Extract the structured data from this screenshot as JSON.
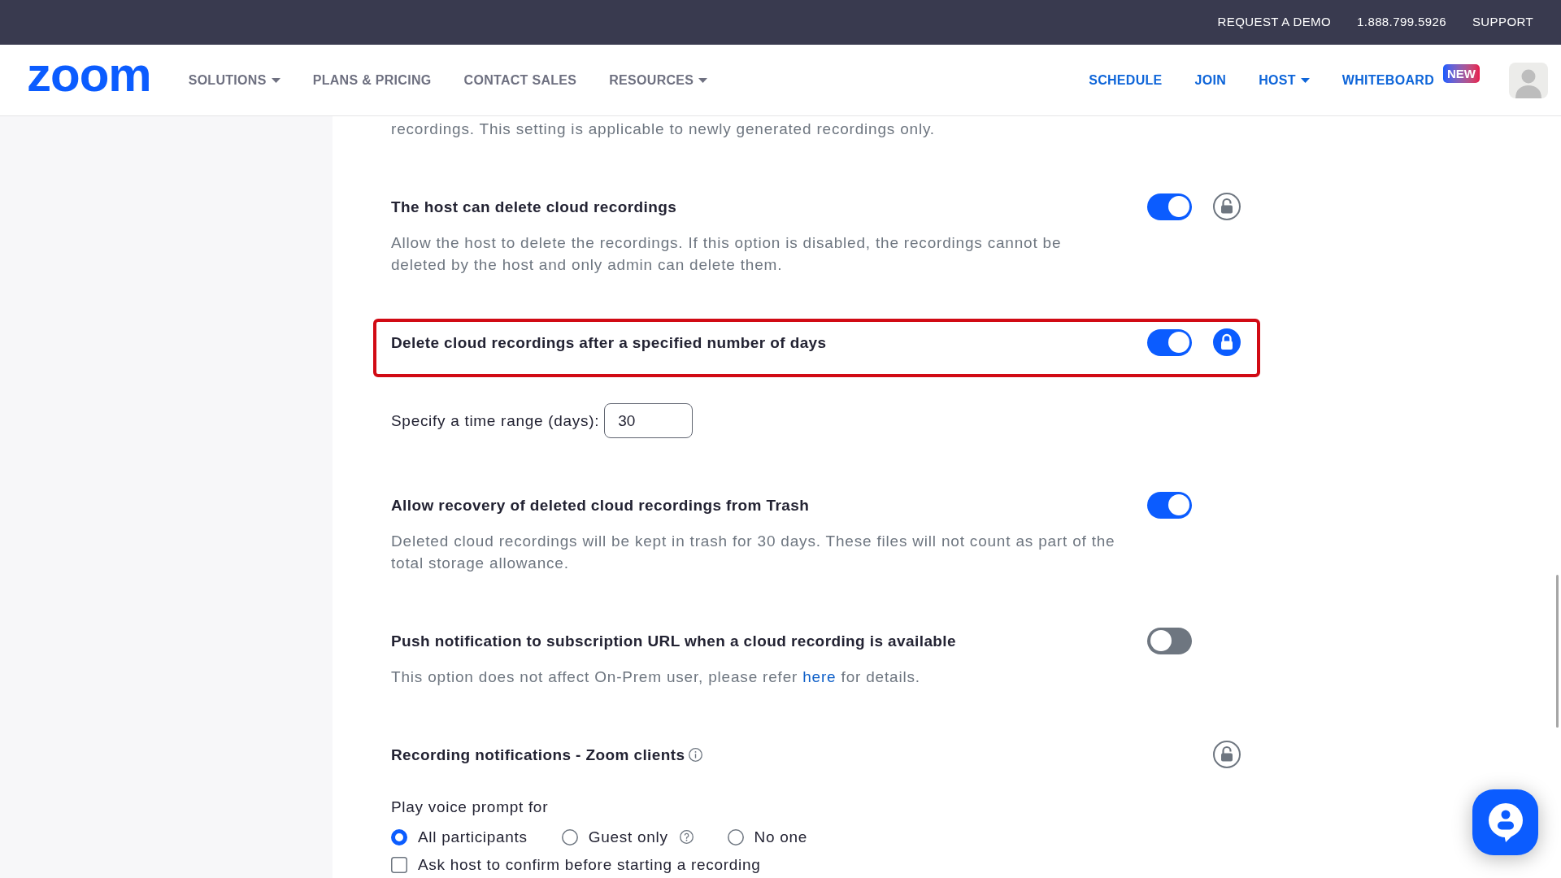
{
  "top_bar": {
    "links": [
      "REQUEST A DEMO",
      "1.888.799.5926",
      "SUPPORT"
    ]
  },
  "nav": {
    "logo": "zoom",
    "left_items": [
      {
        "label": "SOLUTIONS",
        "dropdown": true
      },
      {
        "label": "PLANS & PRICING",
        "dropdown": false
      },
      {
        "label": "CONTACT SALES",
        "dropdown": false
      },
      {
        "label": "RESOURCES",
        "dropdown": true
      }
    ],
    "right_items": [
      {
        "label": "SCHEDULE",
        "dropdown": false
      },
      {
        "label": "JOIN",
        "dropdown": false
      },
      {
        "label": "HOST",
        "dropdown": true
      },
      {
        "label": "WHITEBOARD",
        "dropdown": false,
        "badge": "NEW"
      }
    ]
  },
  "settings": [
    {
      "kind": "description",
      "description": [
        {
          "kind": "text",
          "text": "recordings. This setting is applicable to newly generated recordings only."
        }
      ]
    },
    {
      "kind": "toggle",
      "title": "The host can delete cloud recordings",
      "on": true,
      "locked": false,
      "highlighted": false,
      "description": [
        {
          "kind": "text",
          "text": "Allow the host to delete the recordings. If this option is disabled, the recordings cannot be deleted by the host and only admin can delete them."
        }
      ]
    },
    {
      "kind": "toggle",
      "title": "Delete cloud recordings after a specified number of days",
      "on": true,
      "locked": true,
      "highlighted": true
    },
    {
      "kind": "number",
      "label": "Specify a time range (days):",
      "value": "30"
    },
    {
      "kind": "toggle",
      "title": "Allow recovery of deleted cloud recordings from Trash",
      "on": true,
      "highlighted": false,
      "description": [
        {
          "kind": "text",
          "text": "Deleted cloud recordings will be kept in trash for 30 days. These files will not count as part of the total storage allowance."
        }
      ]
    },
    {
      "kind": "toggle",
      "title": "Push notification to subscription URL when a cloud recording is available",
      "on": false,
      "highlighted": false,
      "description": [
        {
          "kind": "text",
          "text": "This option does not affect On-Prem user, please refer"
        },
        {
          "kind": "link",
          "text": "here"
        },
        {
          "kind": "text",
          "text": "for details."
        }
      ]
    },
    {
      "kind": "options",
      "title": "Recording notifications - Zoom clients",
      "info_icon": true,
      "locked": false,
      "highlighted": false,
      "prompt": "Play voice prompt for",
      "radios": [
        {
          "label": "All participants",
          "selected": true
        },
        {
          "label": "Guest only",
          "selected": false,
          "help_icon": true
        },
        {
          "label": "No one",
          "selected": false
        }
      ],
      "checkbox": {
        "label": "Ask host to confirm before starting a recording",
        "checked": false
      }
    }
  ]
}
